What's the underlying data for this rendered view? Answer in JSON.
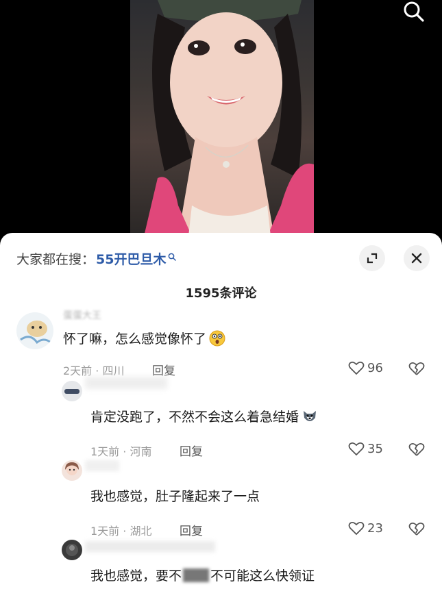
{
  "video": {
    "search_icon": "search-icon"
  },
  "sheet": {
    "search_prefix": "大家都在搜：",
    "search_term": "55开巴旦木",
    "comment_count": "1595条评论"
  },
  "comments": [
    {
      "username": "蛋蛋大王",
      "text": "怀了嘛，怎么感觉像怀了",
      "emoji": "surprised-face-emoji",
      "time": "2天前",
      "location": "四川",
      "reply_label": "回复",
      "likes": "96"
    },
    {
      "username": "",
      "text": "肯定没跑了，不然不会这么着急结婚",
      "emoji": "husky-dog-emoji",
      "time": "1天前",
      "location": "河南",
      "reply_label": "回复",
      "likes": "35"
    },
    {
      "username": "",
      "text": "我也感觉，肚子隆起来了一点",
      "time": "1天前",
      "location": "湖北",
      "reply_label": "回复",
      "likes": "23"
    },
    {
      "username": "",
      "text": "我也感觉，要不",
      "text_tail": "不可能这么快领证"
    }
  ],
  "colors": {
    "accent_link": "#2d5ba8",
    "sheet_bg": "#ffffff",
    "video_bg": "#000000"
  }
}
